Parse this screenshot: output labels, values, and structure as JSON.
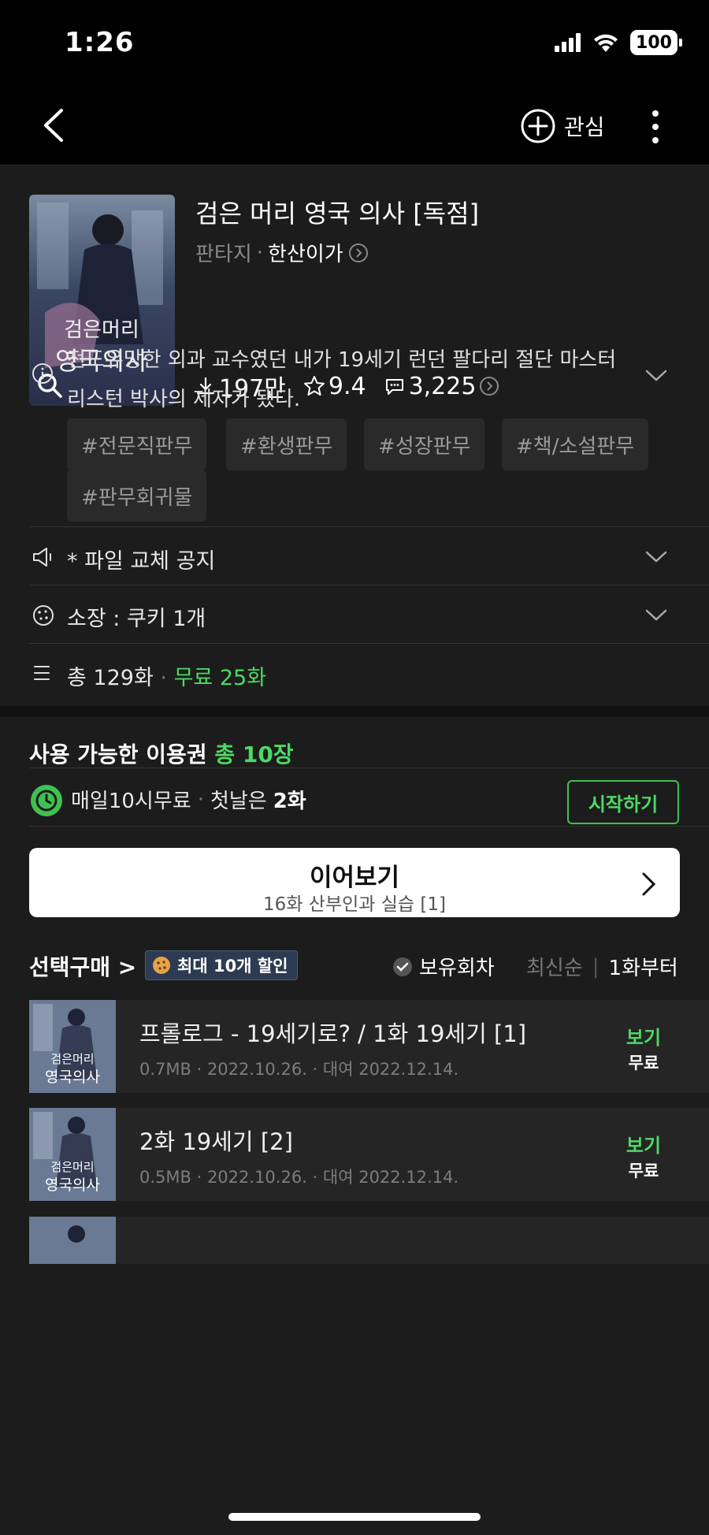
{
  "status_bar": {
    "time": "1:26",
    "battery": "100"
  },
  "nav": {
    "favorite_label": "관심"
  },
  "book": {
    "title": "검은 머리 영국 의사 [독점]",
    "genre": "판타지",
    "author": "한산이가",
    "downloads": "197만",
    "rating": "9.4",
    "comments": "3,225",
    "cover_text": "검은머리 영국의사"
  },
  "synopsis": "전도유망한 외과 교수였던 내가 19세기 런던 팔다리 절단 마스터 리스턴 박사의 제자가 됐다.",
  "tags": [
    "#전문직판무",
    "#환생판무",
    "#성장판무",
    "#책/소설판무",
    "#판무회귀물"
  ],
  "notice": {
    "label": "* 파일 교체 공지"
  },
  "owned": {
    "label": "소장 : 쿠키 1개"
  },
  "episodes_summary": {
    "total": "총 129화",
    "free": "무료 25화"
  },
  "tickets": {
    "title": "사용 가능한 이용권",
    "count": "총 10장",
    "daily_label": "매일10시무료",
    "first_day_prefix": "첫날은",
    "first_day_value": "2화",
    "start_button": "시작하기"
  },
  "continue": {
    "title": "이어보기",
    "subtitle": "16화 산부인과 실습 [1]"
  },
  "select_purchase": {
    "title": "선택구매",
    "discount": "최대 10개 할인",
    "owned_filter": "보유회차",
    "sort_latest": "최신순",
    "sort_first": "1화부터"
  },
  "episode_list": [
    {
      "title": "프롤로그 - 19세기로? / 1화 19세기 [1]",
      "meta": "0.7MB · 2022.10.26. · 대여 2022.12.14.",
      "view": "보기",
      "price": "무료"
    },
    {
      "title": "2화 19세기 [2]",
      "meta": "0.5MB · 2022.10.26. · 대여 2022.12.14.",
      "view": "보기",
      "price": "무료"
    }
  ],
  "colors": {
    "accent": "#4cd964",
    "background": "#1c1c1c",
    "badge": "#2d3b52"
  }
}
